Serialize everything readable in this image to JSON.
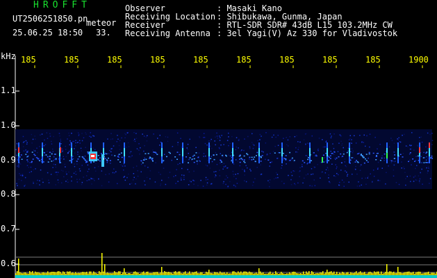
{
  "app": {
    "title": "HROFFT"
  },
  "file": {
    "filename": "UT2506251850.pn",
    "tag": "meteor",
    "date_time": "25.06.25 18:50",
    "count": "33."
  },
  "info_panel": {
    "rows": [
      {
        "label": "Observer",
        "value": ": Masaki Kano"
      },
      {
        "label": "Receiving Location",
        "value": ": Shibukawa, Gunma, Japan"
      },
      {
        "label": "Receiver",
        "value": ": RTL-SDR SDR# 43dB L15 103.2MHz CW"
      },
      {
        "label": "Receiving Antenna",
        "value": ": 3el Yagi(V) Az 330 for Vladivostok"
      }
    ]
  },
  "axes": {
    "y_unit": "kHz",
    "y_ticks": [
      "1.1",
      "1.0",
      "0.9",
      "0.8",
      "0.7",
      "0.6"
    ],
    "x_ticks": [
      "185",
      "185",
      "185",
      "185",
      "185",
      "185",
      "185",
      "185",
      "185",
      "1900"
    ]
  },
  "colors": {
    "background": "#000000",
    "title": "#19e32f",
    "tick": "#ffff00",
    "text": "#ffffff",
    "signal_band": "#0a1a9a",
    "power_trace": "#ffff00",
    "noise_floor": "#00ffff"
  }
}
